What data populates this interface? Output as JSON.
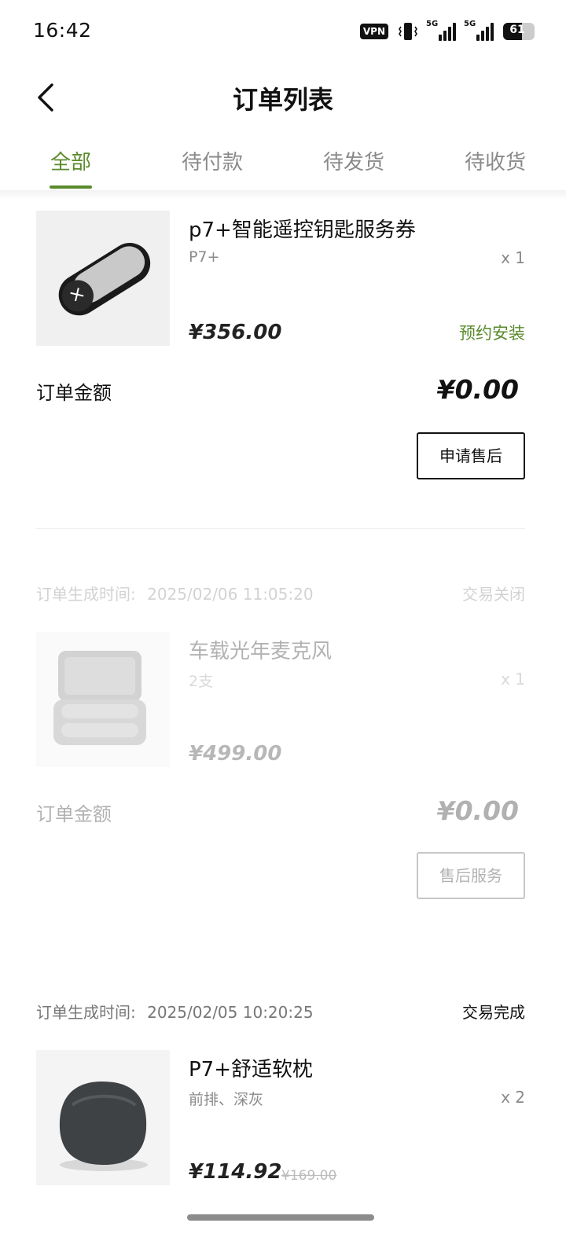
{
  "status_bar": {
    "time": "16:42",
    "vpn": "VPN",
    "signal1": "5G",
    "signal2": "5G",
    "battery": "61",
    "battery_level": 0.61
  },
  "header": {
    "title": "订单列表",
    "back_icon": "chevron-left-icon"
  },
  "tabs": [
    {
      "label": "全部",
      "active": true
    },
    {
      "label": "待付款",
      "active": false
    },
    {
      "label": "待发货",
      "active": false
    },
    {
      "label": "待收货",
      "active": false
    }
  ],
  "orders": [
    {
      "product": "p7+智能遥控钥匙服务券",
      "variant": "P7+",
      "qty": "x 1",
      "price": "¥356.00",
      "action": "预约安装",
      "total_label": "订单金额",
      "total": "¥0.00",
      "button": "申请售后"
    },
    {
      "meta_label": "订单生成时间:",
      "meta_time": "2025/02/06 11:05:20",
      "status": "交易关闭",
      "product": "车载光年麦克风",
      "variant": "2支",
      "qty": "x 1",
      "price": "¥499.00",
      "total_label": "订单金额",
      "total": "¥0.00",
      "button": "售后服务"
    },
    {
      "meta_label": "订单生成时间:",
      "meta_time": "2025/02/05 10:20:25",
      "status": "交易完成",
      "product": "P7+舒适软枕",
      "variant": "前排、深灰",
      "qty": "x 2",
      "price": "¥114.92",
      "original_price": "¥169.00"
    }
  ],
  "colors": {
    "accent": "#5a8a2c",
    "text": "#111111",
    "muted": "#8a8a8a"
  }
}
